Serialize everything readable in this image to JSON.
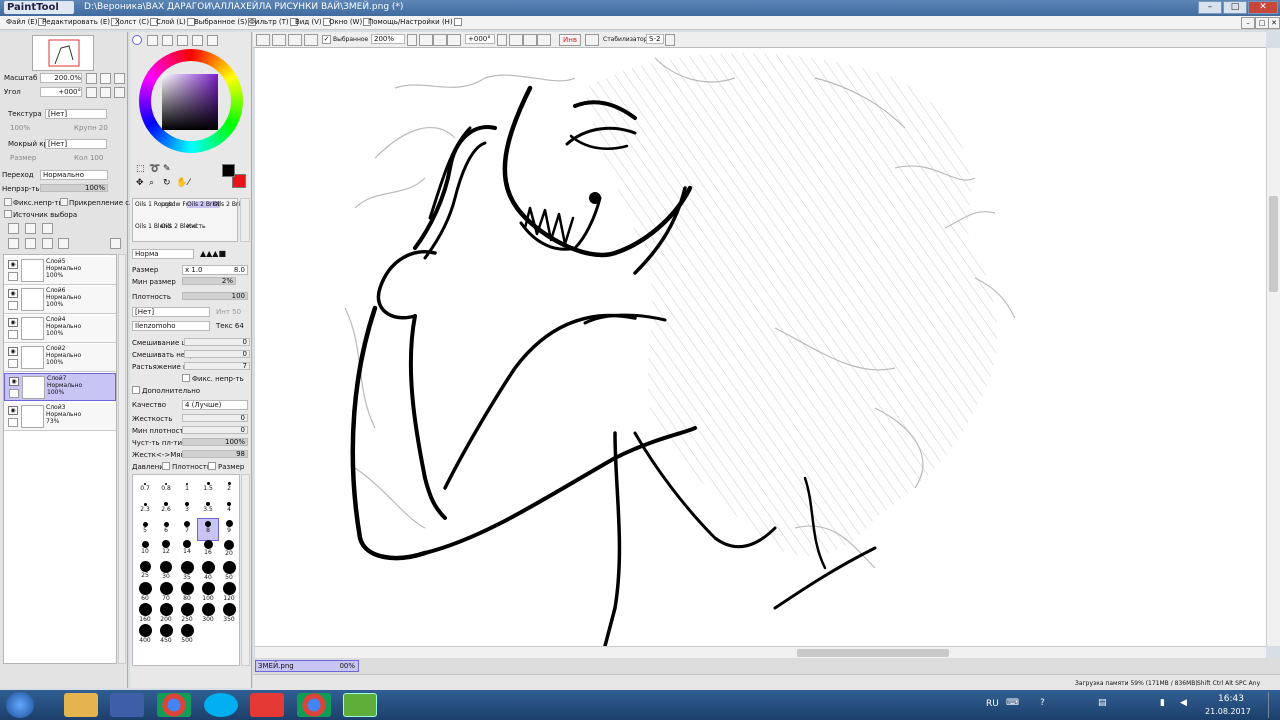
{
  "app": {
    "logo": "PaintTool SAI",
    "title": "D:\\Вероника\\ВАХ ДАРАГОИ\\АЛЛАХЕЙЛА РИСУНКИ ВАЙ\\ЗМЕЙ.png (*)"
  },
  "window_controls": {
    "minimize": "–",
    "maximize": "□",
    "close": "✕",
    "inner_minimize": "–",
    "inner_maximize": "□",
    "inner_close": "✕"
  },
  "menu": [
    "Файл (E)",
    "Редактировать (E)",
    "Холст (C)",
    "Слой (L)",
    "Выбранное (S)",
    "Фильтр (T)",
    "Вид (V)",
    "Окно (W)",
    "Помощь/Настройки (H)"
  ],
  "navigator": {
    "zoom_label": "Масштаб",
    "zoom_value": "200.0%",
    "angle_label": "Угол",
    "angle_value": "+000°"
  },
  "texture": {
    "label": "Текстура",
    "value": "[Нет]",
    "left_val": "100%",
    "right_val": "Крупн 20"
  },
  "wet_edge": {
    "label": "Мокрый край",
    "value": "[Нет]",
    "left_val": "Размер",
    "right_val": "Кол 100"
  },
  "blend": {
    "label": "Переход",
    "value": "Нормально"
  },
  "opacity": {
    "label": "Непрзр-ть",
    "value": "100%"
  },
  "layer_checks": {
    "protect": "Фикс.непр-ть",
    "clip": "Прикрепление слоя",
    "selection_source": "Источник выбора"
  },
  "layers": [
    {
      "name": "Слой5",
      "mode": "Нормально",
      "opacity": "100%"
    },
    {
      "name": "Слой6",
      "mode": "Нормально",
      "opacity": "100%"
    },
    {
      "name": "Слой4",
      "mode": "Нормально",
      "opacity": "100%"
    },
    {
      "name": "Слой2",
      "mode": "Нормально",
      "opacity": "100%"
    },
    {
      "name": "Слой7",
      "mode": "Нормально",
      "opacity": "100%"
    },
    {
      "name": "Слой3",
      "mode": "Нормально",
      "opacity": "73%"
    }
  ],
  "tools": {
    "row1": [
      "Oils 1 Rough",
      "pnsdw Forest",
      "Oils 2 Brist",
      "Oils 2 Brist"
    ],
    "row2": [
      "Oils 1 Blend",
      "Oils 2 Blend",
      "Кисть"
    ]
  },
  "brush": {
    "mode": "Норма",
    "size_label": "Размер",
    "size_mult": "x 1.0",
    "size_value": "8.0",
    "min_size_label": "Мин размер",
    "min_size_value": "2%",
    "density_label": "Плотность",
    "density_value": "100",
    "shape_value": "[Нет]",
    "shape_right": "Инт 50",
    "texture_value": "Ilenzomoho",
    "texture_right": "Текс 64",
    "blend_label": "Смешивание цвет",
    "blend_value": "0",
    "dilution_label": "Смешивать непр",
    "dilution_value": "0",
    "persistence_label": "Растьяжение цвет",
    "persistence_value": "7",
    "keep_opacity": "Фикс. непр-ть",
    "advanced": "Дополнительно",
    "quality_label": "Качество",
    "quality_value": "4 (Лучше)",
    "hardness_label": "Жесткость",
    "hardness_value": "0",
    "min_density_label": "Мин плотность",
    "min_density_value": "0",
    "sensitivity_label": "Чуст-ть пл-ти",
    "sensitivity_value": "100%",
    "hard_soft_label": "Жестк<->Мягк",
    "hard_soft_value": "98",
    "pressure_label": "Давление",
    "pressure_density": "Плотность",
    "pressure_size": "Размер"
  },
  "brush_sizes": [
    "0.7",
    "0.8",
    "1",
    "1.5",
    "2",
    "2.3",
    "2.6",
    "3",
    "3.5",
    "4",
    "5",
    "6",
    "7",
    "8",
    "9",
    "10",
    "12",
    "14",
    "16",
    "20",
    "25",
    "30",
    "35",
    "40",
    "50",
    "60",
    "70",
    "80",
    "100",
    "120",
    "160",
    "200",
    "250",
    "300",
    "350",
    "400",
    "450",
    "500"
  ],
  "canvas_toolbar": {
    "selection_label": "Выбранное",
    "zoom": "200%",
    "angle": "+000°",
    "invert": "Инв",
    "stabilizer_label": "Стабилизатор",
    "stabilizer_value": "S-2"
  },
  "doc_tab": {
    "name": "ЗМЕЙ.png",
    "zoom": "00%"
  },
  "status": {
    "memory": "Загрузка памяти 59% (171MB / 836MB)",
    "keys": "Shift Ctrl Alt SPC Any"
  },
  "taskbar": {
    "lang": "RU",
    "time": "16:43",
    "date": "21.08.2017",
    "apps": [
      "start-orb",
      "explorer-icon",
      "save-icon",
      "chrome-icon",
      "skype-icon",
      "red-app-icon",
      "chrome-icon-2",
      "sai-icon"
    ]
  },
  "colors": {
    "primary": "#000000",
    "secondary": "#e8141c",
    "accent": "#6c66d9"
  }
}
